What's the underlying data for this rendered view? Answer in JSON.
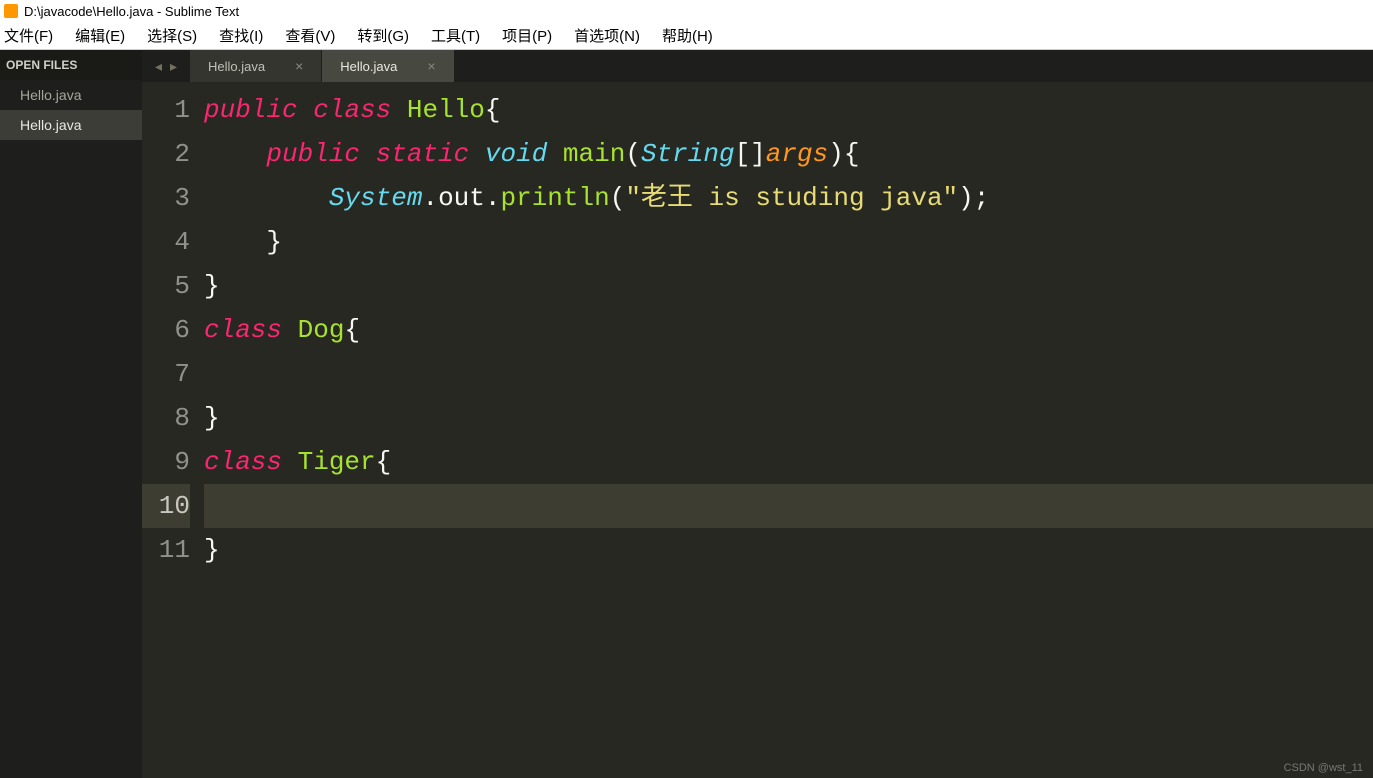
{
  "window": {
    "title": "D:\\javacode\\Hello.java - Sublime Text"
  },
  "menu": {
    "items": [
      "文件(F)",
      "编辑(E)",
      "选择(S)",
      "查找(I)",
      "查看(V)",
      "转到(G)",
      "工具(T)",
      "项目(P)",
      "首选项(N)",
      "帮助(H)"
    ]
  },
  "sidebar": {
    "header": "OPEN FILES",
    "items": [
      {
        "label": "Hello.java",
        "active": false
      },
      {
        "label": "Hello.java",
        "active": true
      }
    ]
  },
  "tabs": {
    "items": [
      {
        "label": "Hello.java",
        "active": false
      },
      {
        "label": "Hello.java",
        "active": true
      }
    ]
  },
  "code": {
    "current_line": 10,
    "lines": [
      [
        {
          "t": "public",
          "c": "kw-red"
        },
        {
          "t": " ",
          "c": "punc"
        },
        {
          "t": "class",
          "c": "kw-red"
        },
        {
          "t": " ",
          "c": "punc"
        },
        {
          "t": "Hello",
          "c": "cls-green"
        },
        {
          "t": "{",
          "c": "punc"
        }
      ],
      [
        {
          "t": "    ",
          "c": "punc"
        },
        {
          "t": "public",
          "c": "kw-red"
        },
        {
          "t": " ",
          "c": "punc"
        },
        {
          "t": "static",
          "c": "kw-red"
        },
        {
          "t": " ",
          "c": "punc"
        },
        {
          "t": "void",
          "c": "kw-cyan"
        },
        {
          "t": " ",
          "c": "punc"
        },
        {
          "t": "main",
          "c": "fn-green"
        },
        {
          "t": "(",
          "c": "punc"
        },
        {
          "t": "String",
          "c": "kw-cyan"
        },
        {
          "t": "[]",
          "c": "punc"
        },
        {
          "t": "args",
          "c": "param"
        },
        {
          "t": "){",
          "c": "punc"
        }
      ],
      [
        {
          "t": "        ",
          "c": "punc"
        },
        {
          "t": "System",
          "c": "kw-cyan"
        },
        {
          "t": ".",
          "c": "punc"
        },
        {
          "t": "out",
          "c": "punc"
        },
        {
          "t": ".",
          "c": "punc"
        },
        {
          "t": "println",
          "c": "fn-green"
        },
        {
          "t": "(",
          "c": "punc"
        },
        {
          "t": "\"老王 is studing java\"",
          "c": "str"
        },
        {
          "t": ");",
          "c": "punc"
        }
      ],
      [
        {
          "t": "    }",
          "c": "punc"
        }
      ],
      [
        {
          "t": "}",
          "c": "punc"
        }
      ],
      [
        {
          "t": "class",
          "c": "kw-red"
        },
        {
          "t": " ",
          "c": "punc"
        },
        {
          "t": "Dog",
          "c": "cls-green"
        },
        {
          "t": "{",
          "c": "punc"
        }
      ],
      [
        {
          "t": "",
          "c": "punc"
        }
      ],
      [
        {
          "t": "}",
          "c": "punc"
        }
      ],
      [
        {
          "t": "class",
          "c": "kw-red"
        },
        {
          "t": " ",
          "c": "punc"
        },
        {
          "t": "Tiger",
          "c": "cls-green"
        },
        {
          "t": "{",
          "c": "punc"
        }
      ],
      [
        {
          "t": "    ",
          "c": "punc"
        }
      ],
      [
        {
          "t": "}",
          "c": "punc"
        }
      ]
    ]
  },
  "watermark": "CSDN @wst_11"
}
